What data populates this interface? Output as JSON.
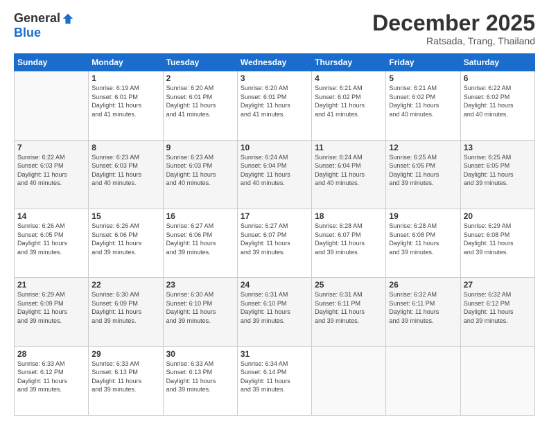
{
  "logo": {
    "general": "General",
    "blue": "Blue"
  },
  "header": {
    "month": "December 2025",
    "location": "Ratsada, Trang, Thailand"
  },
  "weekdays": [
    "Sunday",
    "Monday",
    "Tuesday",
    "Wednesday",
    "Thursday",
    "Friday",
    "Saturday"
  ],
  "weeks": [
    [
      {
        "day": "",
        "sunrise": "",
        "sunset": "",
        "daylight": ""
      },
      {
        "day": "1",
        "sunrise": "Sunrise: 6:19 AM",
        "sunset": "Sunset: 6:01 PM",
        "daylight": "Daylight: 11 hours and 41 minutes."
      },
      {
        "day": "2",
        "sunrise": "Sunrise: 6:20 AM",
        "sunset": "Sunset: 6:01 PM",
        "daylight": "Daylight: 11 hours and 41 minutes."
      },
      {
        "day": "3",
        "sunrise": "Sunrise: 6:20 AM",
        "sunset": "Sunset: 6:01 PM",
        "daylight": "Daylight: 11 hours and 41 minutes."
      },
      {
        "day": "4",
        "sunrise": "Sunrise: 6:21 AM",
        "sunset": "Sunset: 6:02 PM",
        "daylight": "Daylight: 11 hours and 41 minutes."
      },
      {
        "day": "5",
        "sunrise": "Sunrise: 6:21 AM",
        "sunset": "Sunset: 6:02 PM",
        "daylight": "Daylight: 11 hours and 40 minutes."
      },
      {
        "day": "6",
        "sunrise": "Sunrise: 6:22 AM",
        "sunset": "Sunset: 6:02 PM",
        "daylight": "Daylight: 11 hours and 40 minutes."
      }
    ],
    [
      {
        "day": "7",
        "sunrise": "Sunrise: 6:22 AM",
        "sunset": "Sunset: 6:03 PM",
        "daylight": "Daylight: 11 hours and 40 minutes."
      },
      {
        "day": "8",
        "sunrise": "Sunrise: 6:23 AM",
        "sunset": "Sunset: 6:03 PM",
        "daylight": "Daylight: 11 hours and 40 minutes."
      },
      {
        "day": "9",
        "sunrise": "Sunrise: 6:23 AM",
        "sunset": "Sunset: 6:03 PM",
        "daylight": "Daylight: 11 hours and 40 minutes."
      },
      {
        "day": "10",
        "sunrise": "Sunrise: 6:24 AM",
        "sunset": "Sunset: 6:04 PM",
        "daylight": "Daylight: 11 hours and 40 minutes."
      },
      {
        "day": "11",
        "sunrise": "Sunrise: 6:24 AM",
        "sunset": "Sunset: 6:04 PM",
        "daylight": "Daylight: 11 hours and 40 minutes."
      },
      {
        "day": "12",
        "sunrise": "Sunrise: 6:25 AM",
        "sunset": "Sunset: 6:05 PM",
        "daylight": "Daylight: 11 hours and 39 minutes."
      },
      {
        "day": "13",
        "sunrise": "Sunrise: 6:25 AM",
        "sunset": "Sunset: 6:05 PM",
        "daylight": "Daylight: 11 hours and 39 minutes."
      }
    ],
    [
      {
        "day": "14",
        "sunrise": "Sunrise: 6:26 AM",
        "sunset": "Sunset: 6:05 PM",
        "daylight": "Daylight: 11 hours and 39 minutes."
      },
      {
        "day": "15",
        "sunrise": "Sunrise: 6:26 AM",
        "sunset": "Sunset: 6:06 PM",
        "daylight": "Daylight: 11 hours and 39 minutes."
      },
      {
        "day": "16",
        "sunrise": "Sunrise: 6:27 AM",
        "sunset": "Sunset: 6:06 PM",
        "daylight": "Daylight: 11 hours and 39 minutes."
      },
      {
        "day": "17",
        "sunrise": "Sunrise: 6:27 AM",
        "sunset": "Sunset: 6:07 PM",
        "daylight": "Daylight: 11 hours and 39 minutes."
      },
      {
        "day": "18",
        "sunrise": "Sunrise: 6:28 AM",
        "sunset": "Sunset: 6:07 PM",
        "daylight": "Daylight: 11 hours and 39 minutes."
      },
      {
        "day": "19",
        "sunrise": "Sunrise: 6:28 AM",
        "sunset": "Sunset: 6:08 PM",
        "daylight": "Daylight: 11 hours and 39 minutes."
      },
      {
        "day": "20",
        "sunrise": "Sunrise: 6:29 AM",
        "sunset": "Sunset: 6:08 PM",
        "daylight": "Daylight: 11 hours and 39 minutes."
      }
    ],
    [
      {
        "day": "21",
        "sunrise": "Sunrise: 6:29 AM",
        "sunset": "Sunset: 6:09 PM",
        "daylight": "Daylight: 11 hours and 39 minutes."
      },
      {
        "day": "22",
        "sunrise": "Sunrise: 6:30 AM",
        "sunset": "Sunset: 6:09 PM",
        "daylight": "Daylight: 11 hours and 39 minutes."
      },
      {
        "day": "23",
        "sunrise": "Sunrise: 6:30 AM",
        "sunset": "Sunset: 6:10 PM",
        "daylight": "Daylight: 11 hours and 39 minutes."
      },
      {
        "day": "24",
        "sunrise": "Sunrise: 6:31 AM",
        "sunset": "Sunset: 6:10 PM",
        "daylight": "Daylight: 11 hours and 39 minutes."
      },
      {
        "day": "25",
        "sunrise": "Sunrise: 6:31 AM",
        "sunset": "Sunset: 6:11 PM",
        "daylight": "Daylight: 11 hours and 39 minutes."
      },
      {
        "day": "26",
        "sunrise": "Sunrise: 6:32 AM",
        "sunset": "Sunset: 6:11 PM",
        "daylight": "Daylight: 11 hours and 39 minutes."
      },
      {
        "day": "27",
        "sunrise": "Sunrise: 6:32 AM",
        "sunset": "Sunset: 6:12 PM",
        "daylight": "Daylight: 11 hours and 39 minutes."
      }
    ],
    [
      {
        "day": "28",
        "sunrise": "Sunrise: 6:33 AM",
        "sunset": "Sunset: 6:12 PM",
        "daylight": "Daylight: 11 hours and 39 minutes."
      },
      {
        "day": "29",
        "sunrise": "Sunrise: 6:33 AM",
        "sunset": "Sunset: 6:13 PM",
        "daylight": "Daylight: 11 hours and 39 minutes."
      },
      {
        "day": "30",
        "sunrise": "Sunrise: 6:33 AM",
        "sunset": "Sunset: 6:13 PM",
        "daylight": "Daylight: 11 hours and 39 minutes."
      },
      {
        "day": "31",
        "sunrise": "Sunrise: 6:34 AM",
        "sunset": "Sunset: 6:14 PM",
        "daylight": "Daylight: 11 hours and 39 minutes."
      },
      {
        "day": "",
        "sunrise": "",
        "sunset": "",
        "daylight": ""
      },
      {
        "day": "",
        "sunrise": "",
        "sunset": "",
        "daylight": ""
      },
      {
        "day": "",
        "sunrise": "",
        "sunset": "",
        "daylight": ""
      }
    ]
  ]
}
